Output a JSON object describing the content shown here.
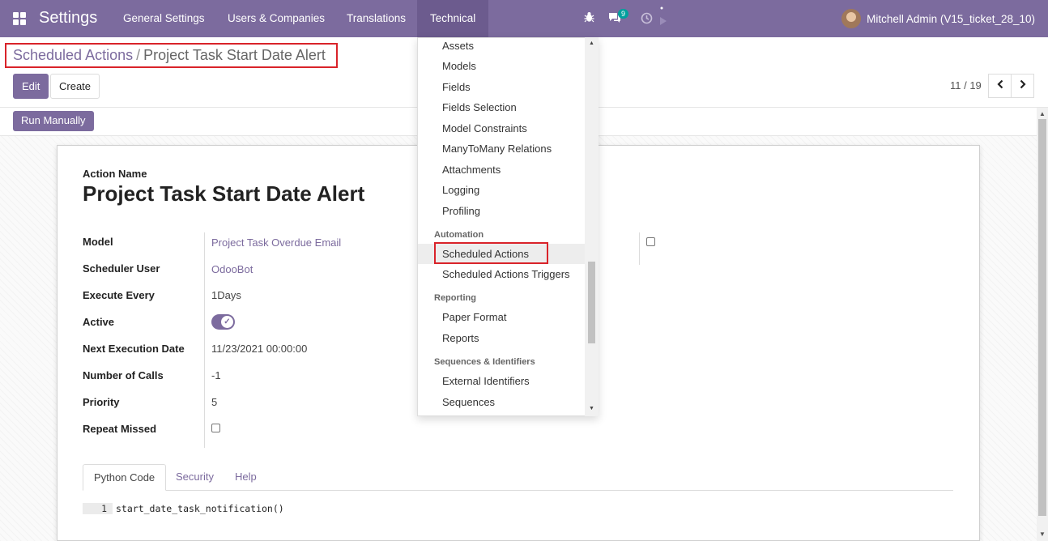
{
  "navbar": {
    "app_title": "Settings",
    "menu": [
      "General Settings",
      "Users & Companies",
      "Translations",
      "Technical"
    ],
    "message_count": "9",
    "user_name": "Mitchell Admin (V15_ticket_28_10)",
    "color": "#7c6b9e"
  },
  "breadcrumb": {
    "parent": "Scheduled Actions",
    "separator": "/",
    "current": "Project Task Start Date Alert"
  },
  "buttons": {
    "edit": "Edit",
    "create": "Create",
    "run_manually": "Run Manually"
  },
  "pager": {
    "value": "11 / 19",
    "prev_icon": "chevron-left-icon",
    "next_icon": "chevron-right-icon"
  },
  "form": {
    "name_label": "Action Name",
    "name": "Project Task Start Date Alert",
    "fields": [
      {
        "label": "Model",
        "value": "Project Task Overdue Email"
      },
      {
        "label": "Scheduler User",
        "value": "OdooBot"
      },
      {
        "label": "Execute Every",
        "value": "1Days"
      },
      {
        "label": "Active",
        "value": true
      },
      {
        "label": "Next Execution Date",
        "value": "11/23/2021 00:00:00"
      },
      {
        "label": "Number of Calls",
        "value": "-1"
      },
      {
        "label": "Priority",
        "value": "5"
      },
      {
        "label": "Repeat Missed",
        "value": false
      }
    ]
  },
  "tabs": [
    "Python Code",
    "Security",
    "Help"
  ],
  "code": {
    "line_number": "1",
    "text": "start_date_task_notification()"
  },
  "dropdown": {
    "items_top": [
      "Assets",
      "Models",
      "Fields",
      "Fields Selection",
      "Model Constraints",
      "ManyToMany Relations",
      "Attachments",
      "Logging",
      "Profiling"
    ],
    "automation_header": "Automation",
    "automation_items": [
      "Scheduled Actions",
      "Scheduled Actions Triggers"
    ],
    "reporting_header": "Reporting",
    "reporting_items": [
      "Paper Format",
      "Reports"
    ],
    "sequences_header": "Sequences & Identifiers",
    "sequences_items": [
      "External Identifiers",
      "Sequences"
    ],
    "selected": "Scheduled Actions"
  }
}
